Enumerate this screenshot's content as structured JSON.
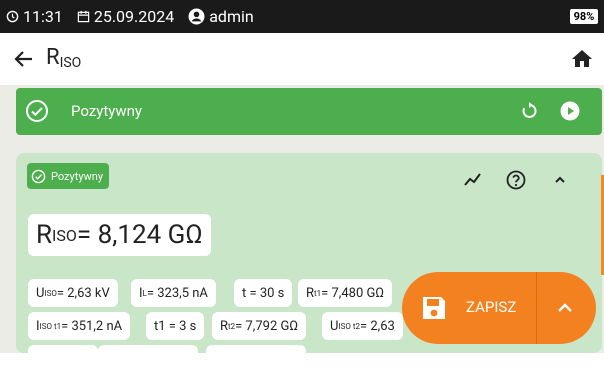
{
  "status": {
    "time": "11:31",
    "date": "25.09.2024",
    "user": "admin",
    "battery": "98%"
  },
  "header": {
    "title_main": "R",
    "title_sub": "ISO"
  },
  "banner": {
    "text": "Pozytywny"
  },
  "card": {
    "badge": "Pozytywny",
    "result": {
      "sym": "R",
      "sub": "ISO",
      "val": " = 8,124 GΩ"
    },
    "row1": [
      {
        "sym": "U",
        "sub": "ISO",
        "val": " = 2,63 kV"
      },
      {
        "sym": "I",
        "sub": "L",
        "val": " = 323,5 nA"
      },
      {
        "sym": "",
        "sub": "",
        "val": "t = 30 s"
      },
      {
        "sym": "R",
        "sub": "t1",
        "val": " = 7,480 GΩ"
      }
    ],
    "row2": [
      {
        "sym": "I",
        "sub": "ISO t1",
        "val": " = 351,2 nA"
      },
      {
        "sym": "",
        "sub": "",
        "val": "t1 = 3 s"
      },
      {
        "sym": "R",
        "sub": "t2",
        "val": " = 7,792 GΩ"
      },
      {
        "sym": "U",
        "sub": "ISO t2",
        "val": " = 2,63"
      }
    ]
  },
  "fab": {
    "label": "ZAPISZ"
  },
  "colors": {
    "green": "#4cae4c",
    "orange": "#f4811f",
    "card": "#c9e6c9"
  }
}
